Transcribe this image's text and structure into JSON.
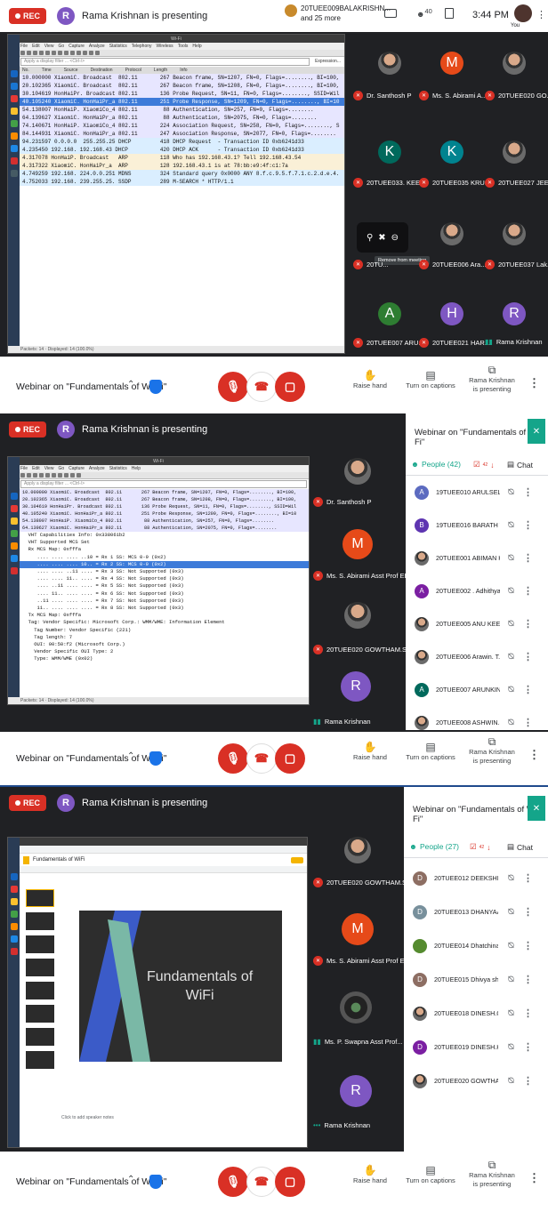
{
  "colors": {
    "rec": "#d93025",
    "presenter": "#7e57c2",
    "teal": "#14a58a",
    "frame": "#1f4a8c"
  },
  "panel1": {
    "rec": "REC",
    "presenter_initial": "R",
    "presenting": "Rama Krishnan is presenting",
    "raised": {
      "name": "20TUEE009BALAKRISHN...",
      "more": "and 25 more"
    },
    "icons_count": "40",
    "time": "3:44 PM",
    "you": "You",
    "wireshark": {
      "filter": "Apply a display filter ... <Ctrl-/>",
      "expression": "Expression...",
      "cols": [
        "No.",
        "Time",
        "Source",
        "Destination",
        "Protocol",
        "Length",
        "Info"
      ],
      "rows": [
        "10.000000 XiaomiC. Broadcast  802.11       267 Beacon frame, SN=1207, FN=0, Flags=........, BI=100,",
        "20.102365 XiaomiC. Broadcast  802.11       267 Beacon frame, SN=1208, FN=0, Flags=........, BI=100,",
        "30.104619 HonHaiPr. Broadcast 802.11       136 Probe Request, SN=11, FN=0, Flags=........, SSID=Wil",
        "40.105240 XiaomiC. HonHaiPr_a 802.11       251 Probe Response, SN=1209, FN=0, Flags=........, BI=10",
        "54.138007 HonHaiP. XiaomiCo_4 802.11        88 Authentication, SN=257, FN=0, Flags=........",
        "64.139627 XiaomiC. HonHaiPr_a 802.11        88 Authentication, SN=2075, FN=0, Flags=........",
        "74.140671 HonHaiP. XiaomiCo_4 802.11       224 Association Request, SN=258, FN=0, Flags=........, S",
        "84.144931 XiaomiC. HonHaiPr_a 802.11       247 Association Response, SN=2077, FN=0, Flags=........",
        "94.231597 0.0.0.0  255.255.25 DHCP         418 DHCP Request  - Transaction ID 0xb6241d33",
        "4.235450 192.168. 192.168.43 DHCP          420 DHCP ACK      - Transaction ID 0xb6241d33",
        "4.317078 HonHaiP. Broadcast   ARP          118 Who has 192.168.43.1? Tell 192.168.43.54",
        "4.317322 XiaomiC. HonHaiPr_a  ARP          128 192.168.43.1 is at 78:bb:e9:4f:c1:7a",
        "4.749259 192.168. 224.0.0.251 MDNS         324 Standard query 0x0000 ANY 8.f.c.9.5.f.7.1.c.2.d.e.4.",
        "4.752033 192.168. 239.255.25. SSDP         289 M-SEARCH * HTTP/1.1"
      ],
      "status": "Packets: 14 · Displayed: 14 (100.0%)"
    },
    "tiles": [
      {
        "name": "Dr. Santhosh P",
        "initial": ""
      },
      {
        "name": "Ms. S. Abirami A...",
        "initial": "M"
      },
      {
        "name": "20TUEE020 GO...",
        "initial": ""
      },
      {
        "name": "20TUEE033. KEE...",
        "initial": "K"
      },
      {
        "name": "20TUEE035 KRU...",
        "initial": "K"
      },
      {
        "name": "20TUEE027 JEE...",
        "initial": ""
      },
      {
        "name": "20TU...",
        "initial": ""
      },
      {
        "name": "20TUEE006 Ara...",
        "initial": ""
      },
      {
        "name": "20TUEE037 Lak...",
        "initial": ""
      },
      {
        "name": "20TUEE007 ARU...",
        "initial": "A"
      },
      {
        "name": "20TUEE021 HAR...",
        "initial": "H"
      },
      {
        "name": "Rama Krishnan",
        "initial": "R"
      }
    ],
    "tooltip": "Remove from meeting"
  },
  "panel2": {
    "rec": "REC",
    "presenter_initial": "R",
    "presenting": "Rama Krishnan is presenting",
    "detail": [
      "  VHT Capabilities Info: 0x338061b2",
      "  VHT Supported MCS Set",
      "  Rx MCS Map: 0xfffa",
      "     .... .... .... ..10 = Rx 1 SS: MCS 0-9 (0x2)",
      "     .... .... .... 10.. = Rx 2 SS: MCS 0-9 (0x2)",
      "     .... .... ..11 .... = Rx 3 SS: Not Supported (0x3)",
      "     .... .... 11.. .... = Rx 4 SS: Not Supported (0x3)",
      "     .... ..11 .... .... = Rx 5 SS: Not Supported (0x3)",
      "     .... 11.. .... .... = Rx 6 SS: Not Supported (0x3)",
      "     ..11 .... .... .... = Rx 7 SS: Not Supported (0x3)",
      "     11.. .... .... .... = Rx 8 SS: Not Supported (0x3)",
      "  Tx MCS Map: 0xfffa",
      "  Tag: Vendor Specific: Microsoft Corp.: WMM/WME: Information Element",
      "    Tag Number: Vendor Specific (221)",
      "    Tag length: 7",
      "    OUI: 00:50:f2 (Microsoft Corp.)",
      "    Vendor Specific OUI Type: 2",
      "    Type: WMM/WME (0x02)"
    ],
    "tiles": [
      {
        "name": "Dr. Santhosh P",
        "initial": ""
      },
      {
        "name": "Ms. S. Abirami Asst Prof EEE",
        "initial": "M"
      },
      {
        "name": "20TUEE020 GOWTHAM.S",
        "initial": ""
      },
      {
        "name": "Rama Krishnan",
        "initial": "R"
      }
    ],
    "side": {
      "title": "Webinar on \"Fundamentals of Wi-Fi\"",
      "people": "People (42)",
      "raise_count": "42",
      "chat": "Chat",
      "rows": [
        {
          "name": "19TUEE010 ARULSELVI...",
          "initial": "A",
          "color": "#5c6bc0"
        },
        {
          "name": "19TUEE016 BARATH VIG...",
          "initial": "B",
          "color": "#5e35b1"
        },
        {
          "name": "20TUEE001 ABIMAN KU...",
          "initial": "",
          "color": "#8d6e63"
        },
        {
          "name": "20TUEE002 . Adhithya",
          "initial": "A",
          "color": "#7b1fa2"
        },
        {
          "name": "20TUEE005 ANU KEERT...",
          "initial": "",
          "color": "#6d4c41"
        },
        {
          "name": "20TUEE006 Arawin. T. S",
          "initial": "",
          "color": "#5d4037"
        },
        {
          "name": "20TUEE007 ARUNKING...",
          "initial": "A",
          "color": "#00695c"
        },
        {
          "name": "20TUEE008 ASHWIN.S",
          "initial": "",
          "color": "#9e9e9e"
        }
      ]
    }
  },
  "panel3": {
    "rec": "REC",
    "presenter_initial": "R",
    "presenting": "Rama Krishnan is presenting",
    "slide_title_1": "Fundamentals of",
    "slide_title_2": "WiFi",
    "doc_name": "Fundamentals of WiFi",
    "notes": "Click to add speaker notes",
    "tiles": [
      {
        "name": "20TUEE020 GOWTHAM.S",
        "initial": ""
      },
      {
        "name": "Ms. S. Abirami Asst Prof EEE",
        "initial": "M"
      },
      {
        "name": "Ms. P. Swapna Asst Prof...",
        "initial": ""
      },
      {
        "name": "Rama Krishnan",
        "initial": "R"
      }
    ],
    "side": {
      "title": "Webinar on \"Fundamentals of Wi-Fi\"",
      "people": "People (27)",
      "raise_count": "42",
      "chat": "Chat",
      "rows": [
        {
          "name": "20TUEE012 DEEKSHITH...",
          "initial": "D",
          "color": "#8d6e63"
        },
        {
          "name": "20TUEE013 DHANYAA.N",
          "initial": "D",
          "color": "#78909c"
        },
        {
          "name": "20TUEE014 Dhatchinam...",
          "initial": "",
          "color": "#558b2f"
        },
        {
          "name": "20TUEE015 Dhivya shri T",
          "initial": "D",
          "color": "#8d6e63"
        },
        {
          "name": "20TUEE018 DINESH.C",
          "initial": "",
          "color": "#6d4c41"
        },
        {
          "name": "20TUEE019 DINESH.K",
          "initial": "D",
          "color": "#7b1fa2"
        },
        {
          "name": "20TUEE020 GOWTHA...",
          "initial": "",
          "color": "#9e9e9e"
        }
      ]
    }
  },
  "bottom": {
    "webinar": "Webinar on \"Fundamentals of Wi-Fi\"",
    "raise_hand": "Raise hand",
    "captions": "Turn on captions",
    "presenting_1": "Rama Krishnan",
    "presenting_2": "is presenting"
  }
}
